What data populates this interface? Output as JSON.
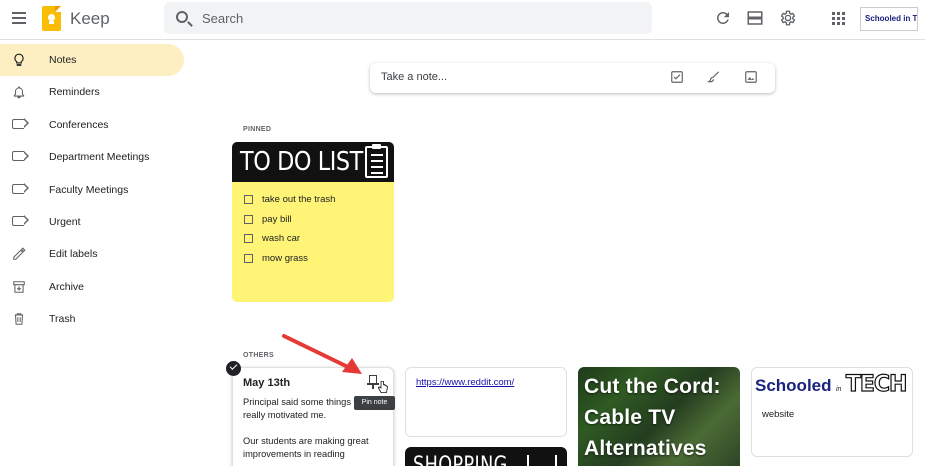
{
  "header": {
    "app_title": "Keep",
    "search_placeholder": "Search",
    "account_label": "Schooled in TECH"
  },
  "sidebar": {
    "items": [
      {
        "label": "Notes",
        "icon": "lightbulb-icon",
        "active": true
      },
      {
        "label": "Reminders",
        "icon": "bell-icon"
      },
      {
        "label": "Conferences",
        "icon": "label-icon"
      },
      {
        "label": "Department Meetings",
        "icon": "label-icon"
      },
      {
        "label": "Faculty Meetings",
        "icon": "label-icon"
      },
      {
        "label": "Urgent",
        "icon": "label-icon"
      },
      {
        "label": "Edit labels",
        "icon": "pencil-icon"
      },
      {
        "label": "Archive",
        "icon": "archive-icon"
      },
      {
        "label": "Trash",
        "icon": "trash-icon"
      }
    ]
  },
  "composer": {
    "placeholder": "Take a note..."
  },
  "sections": {
    "pinned": "PINNED",
    "others": "OTHERS"
  },
  "todo_card": {
    "title": "TO DO LIST",
    "items": [
      "take out the trash",
      "pay bill",
      "wash car",
      "mow grass"
    ]
  },
  "may_card": {
    "title": "May 13th",
    "body_1": "Principal said some things that really motivated me.",
    "body_2": "Our students are making great improvements in reading",
    "pin_tooltip": "Pin note"
  },
  "link_card": {
    "url": "https://www.reddit.com/"
  },
  "shopping_card": {
    "title": "SHOPPING"
  },
  "cable_card": {
    "line1": "Cut the Cord:",
    "line2": "Cable TV",
    "line3": "Alternatives"
  },
  "schooled_card": {
    "logo_part1": "Schooled",
    "logo_part2": "in",
    "logo_part3": "TECH",
    "caption": "website"
  },
  "colors": {
    "active_nav": "#feefc3",
    "todo_note": "#fff475",
    "annotation_arrow": "#e53935"
  }
}
